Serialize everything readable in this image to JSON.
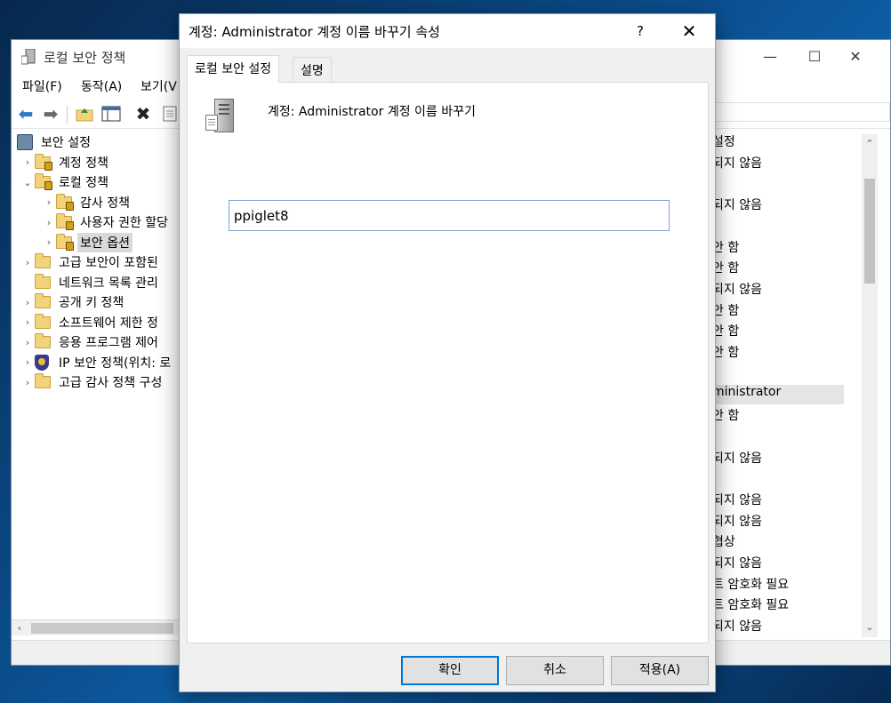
{
  "background_window": {
    "title": "로컬 보안 정책",
    "menu": [
      "파일(F)",
      "동작(A)",
      "보기(V"
    ],
    "tree": [
      {
        "label": "보안 설정",
        "indent": 0,
        "caret": "",
        "icon": "pc"
      },
      {
        "label": "계정 정책",
        "indent": 1,
        "caret": "›",
        "icon": "locked-folder"
      },
      {
        "label": "로컬 정책",
        "indent": 1,
        "caret": "⌄",
        "icon": "locked-folder"
      },
      {
        "label": "감사 정책",
        "indent": 2,
        "caret": "›",
        "icon": "locked-folder"
      },
      {
        "label": "사용자 권한 할당",
        "indent": 2,
        "caret": "›",
        "icon": "locked-folder"
      },
      {
        "label": "보안 옵션",
        "indent": 2,
        "caret": "›",
        "icon": "locked-folder",
        "selected": true
      },
      {
        "label": "고급 보안이 포함된",
        "indent": 1,
        "caret": "›",
        "icon": "folder"
      },
      {
        "label": "네트워크 목록 관리",
        "indent": 1,
        "caret": "",
        "icon": "folder"
      },
      {
        "label": "공개 키 정책",
        "indent": 1,
        "caret": "›",
        "icon": "folder"
      },
      {
        "label": "소프트웨어 제한 정",
        "indent": 1,
        "caret": "›",
        "icon": "folder"
      },
      {
        "label": "응용 프로그램 제어",
        "indent": 1,
        "caret": "›",
        "icon": "folder"
      },
      {
        "label": "IP 보안 정책(위치: 로",
        "indent": 1,
        "caret": "›",
        "icon": "shield"
      },
      {
        "label": "고급 감사 정책 구성",
        "indent": 1,
        "caret": "›",
        "icon": "folder"
      }
    ],
    "right_column": [
      {
        "text": "설정",
        "row": 0
      },
      {
        "text": "되지 않음",
        "row": 1
      },
      {
        "text": "되지 않음",
        "row": 3
      },
      {
        "text": "안 함",
        "row": 5
      },
      {
        "text": "안 함",
        "row": 6
      },
      {
        "text": "되지 않음",
        "row": 7
      },
      {
        "text": "안 함",
        "row": 8
      },
      {
        "text": "안 함",
        "row": 9
      },
      {
        "text": "안 함",
        "row": 10
      },
      {
        "text": "ministrator",
        "row": 12,
        "highlight": true
      },
      {
        "text": "안 함",
        "row": 13
      },
      {
        "text": "",
        "row": 14
      },
      {
        "text": "되지 않음",
        "row": 15
      },
      {
        "text": "되지 않음",
        "row": 17
      },
      {
        "text": "되지 않음",
        "row": 18
      },
      {
        "text": "협상",
        "row": 19
      },
      {
        "text": "되지 않음",
        "row": 20
      },
      {
        "text": "트 암호화 필요",
        "row": 21
      },
      {
        "text": "트 암호화 필요",
        "row": 22
      },
      {
        "text": "되지 않음",
        "row": 23
      }
    ]
  },
  "dialog": {
    "title": "계정: Administrator 계정 이름 바꾸기 속성",
    "help_label": "?",
    "close_label": "✕",
    "tabs": [
      "로컬 보안 설정",
      "설명"
    ],
    "heading": "계정: Administrator 계정 이름 바꾸기",
    "input_value": "ppiglet8",
    "buttons": {
      "ok": "확인",
      "cancel": "취소",
      "apply": "적용(A)"
    }
  },
  "window_controls": {
    "minimize": "—",
    "maximize": "☐",
    "close": "✕"
  },
  "colors": {
    "accent": "#0078d7",
    "selection": "#d9d9d9"
  }
}
